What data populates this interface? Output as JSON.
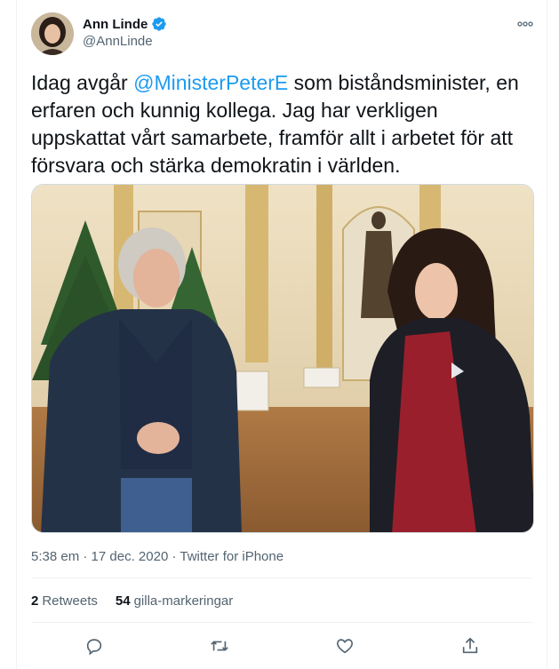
{
  "author": {
    "display_name": "Ann Linde",
    "handle": "@AnnLinde",
    "verified_icon": "verified-badge-icon"
  },
  "tweet": {
    "text_before": "Idag avgår ",
    "mention": "@MinisterPeterE",
    "text_after": " som biståndsminister, en erfaren och kunnig kollega. Jag har verkligen uppskattat vårt samarbete, framför allt i arbetet för att försvara och stärka demokratin i världen."
  },
  "meta": {
    "time": "5:38 em",
    "sep1": " · ",
    "date": "17 dec. 2020",
    "sep2": " · ",
    "source": "Twitter for iPhone"
  },
  "stats": {
    "retweets_count": "2",
    "retweets_label": "Retweets",
    "likes_count": "54",
    "likes_label": "gilla-markeringar"
  },
  "actions": [
    "reply-icon",
    "retweet-icon",
    "like-icon",
    "share-icon"
  ],
  "colors": {
    "link": "#1d9bf0",
    "secondary_text": "#536471",
    "divider": "#eff3f4"
  }
}
